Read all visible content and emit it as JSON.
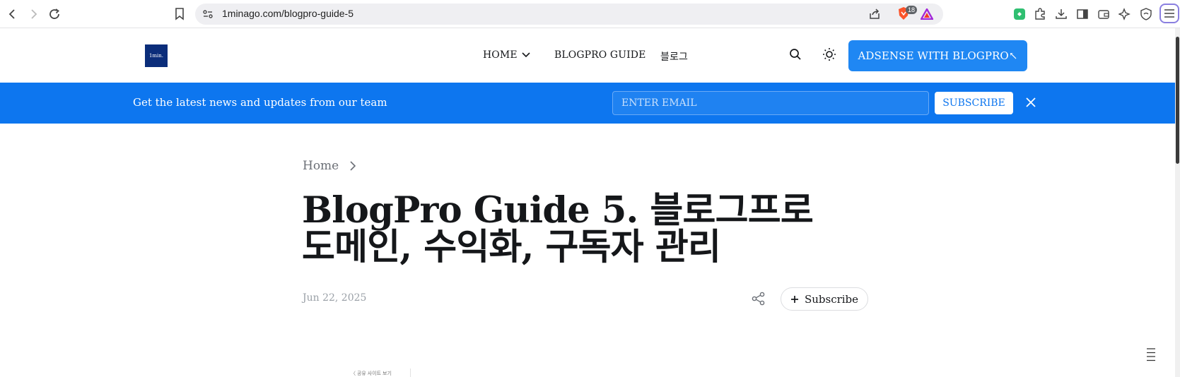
{
  "browser": {
    "url": "1minago.com/blogpro-guide-5",
    "brave_badge": "18",
    "icons": [
      "back-icon",
      "forward-icon",
      "reload-icon",
      "bookmark-icon",
      "site-info-icon",
      "share-icon",
      "brave-shield-icon",
      "brave-rewards-icon",
      "extension-green-icon",
      "puzzle-icon",
      "download-icon",
      "sidebar-icon",
      "wallet-icon",
      "leo-ai-icon",
      "vpn-icon",
      "menu-icon"
    ]
  },
  "site": {
    "logo_text": "1min.",
    "nav": {
      "home": "HOME",
      "guide": "BLOGPRO GUIDE",
      "blog": "블로그"
    },
    "cta_label": "ADSENSE WITH BLOGPRO↖"
  },
  "announcement": {
    "message": "Get the latest news and updates from our team",
    "email_placeholder": "ENTER EMAIL",
    "subscribe_label": "SUBSCRIBE"
  },
  "article": {
    "breadcrumb_home": "Home",
    "title": "BlogPro Guide 5. 블로그프로 도메인, 수익화, 구독자 관리",
    "date": "Jun 22, 2025",
    "subscribe_label": "Subscribe",
    "thumb_caption": "〈 공유 사이트 보기"
  },
  "colors": {
    "accent": "#0d76ef",
    "cta": "#1f87f3",
    "logo_bg": "#0b2d7a"
  }
}
